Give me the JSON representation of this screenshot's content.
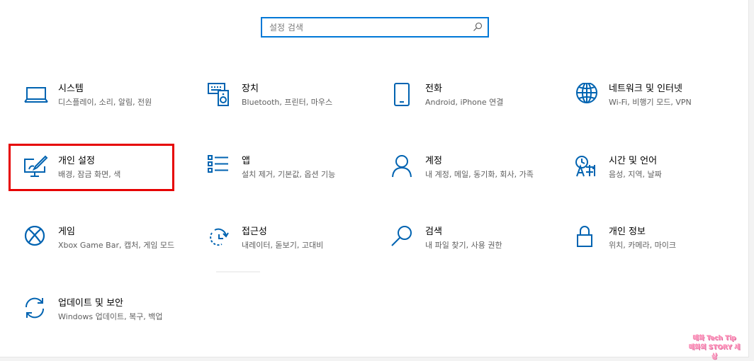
{
  "search": {
    "placeholder": "설정 검색",
    "value": ""
  },
  "accent_color": "#0078d7",
  "highlight_color": "#e60000",
  "tiles": [
    {
      "icon": "laptop-icon",
      "title": "시스템",
      "desc": "디스플레이, 소리, 알림, 전원"
    },
    {
      "icon": "devices-icon",
      "title": "장치",
      "desc": "Bluetooth, 프린터, 마우스"
    },
    {
      "icon": "phone-icon",
      "title": "전화",
      "desc": "Android, iPhone 연결"
    },
    {
      "icon": "globe-icon",
      "title": "네트워크 및 인터넷",
      "desc": "Wi-Fi, 비행기 모드, VPN"
    },
    {
      "icon": "personalization-icon",
      "title": "개인 설정",
      "desc": "배경, 잠금 화면, 색"
    },
    {
      "icon": "apps-list-icon",
      "title": "앱",
      "desc": "설치 제거, 기본값, 옵션 기능"
    },
    {
      "icon": "person-icon",
      "title": "계정",
      "desc": "내 계정, 메일, 동기화, 회사, 가족"
    },
    {
      "icon": "time-language-icon",
      "title": "시간 및 언어",
      "desc": "음성, 지역, 날짜"
    },
    {
      "icon": "xbox-icon",
      "title": "게임",
      "desc": "Xbox Game Bar, 캡처, 게임 모드"
    },
    {
      "icon": "ease-of-access-icon",
      "title": "접근성",
      "desc": "내레이터, 돋보기, 고대비"
    },
    {
      "icon": "search-icon",
      "title": "검색",
      "desc": "내 파일 찾기, 사용 권한"
    },
    {
      "icon": "lock-icon",
      "title": "개인 정보",
      "desc": "위치, 카메라, 마이크"
    },
    {
      "icon": "sync-icon",
      "title": "업데이트 및 보안",
      "desc": "Windows 업데이트, 복구, 백업"
    }
  ],
  "watermark": {
    "line1": "매화 Tech Tip",
    "line2": "매화의 STORY 세상"
  }
}
